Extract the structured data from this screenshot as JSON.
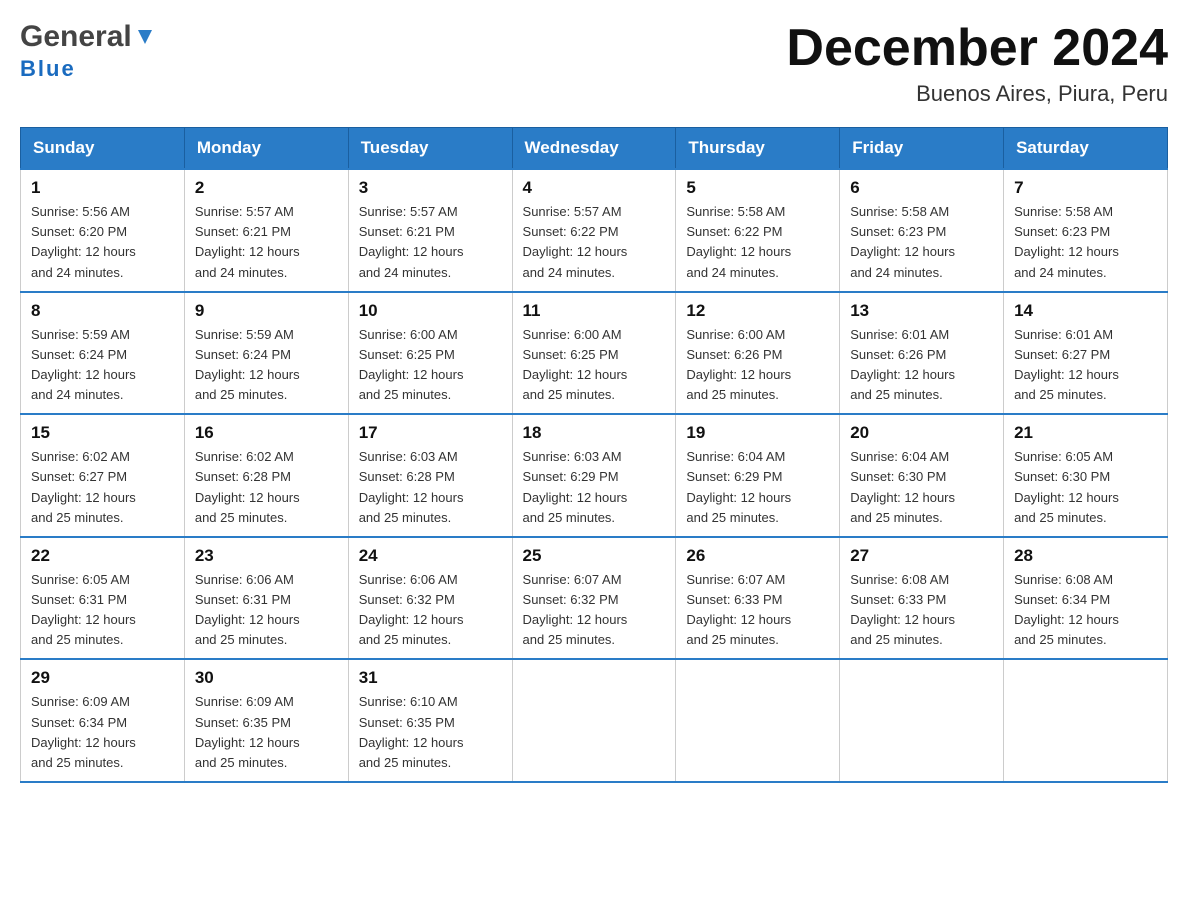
{
  "header": {
    "logo_general": "General",
    "logo_blue": "Blue",
    "title": "December 2024",
    "subtitle": "Buenos Aires, Piura, Peru"
  },
  "days_of_week": [
    "Sunday",
    "Monday",
    "Tuesday",
    "Wednesday",
    "Thursday",
    "Friday",
    "Saturday"
  ],
  "weeks": [
    [
      {
        "day": "1",
        "sunrise": "5:56 AM",
        "sunset": "6:20 PM",
        "daylight": "12 hours and 24 minutes."
      },
      {
        "day": "2",
        "sunrise": "5:57 AM",
        "sunset": "6:21 PM",
        "daylight": "12 hours and 24 minutes."
      },
      {
        "day": "3",
        "sunrise": "5:57 AM",
        "sunset": "6:21 PM",
        "daylight": "12 hours and 24 minutes."
      },
      {
        "day": "4",
        "sunrise": "5:57 AM",
        "sunset": "6:22 PM",
        "daylight": "12 hours and 24 minutes."
      },
      {
        "day": "5",
        "sunrise": "5:58 AM",
        "sunset": "6:22 PM",
        "daylight": "12 hours and 24 minutes."
      },
      {
        "day": "6",
        "sunrise": "5:58 AM",
        "sunset": "6:23 PM",
        "daylight": "12 hours and 24 minutes."
      },
      {
        "day": "7",
        "sunrise": "5:58 AM",
        "sunset": "6:23 PM",
        "daylight": "12 hours and 24 minutes."
      }
    ],
    [
      {
        "day": "8",
        "sunrise": "5:59 AM",
        "sunset": "6:24 PM",
        "daylight": "12 hours and 24 minutes."
      },
      {
        "day": "9",
        "sunrise": "5:59 AM",
        "sunset": "6:24 PM",
        "daylight": "12 hours and 25 minutes."
      },
      {
        "day": "10",
        "sunrise": "6:00 AM",
        "sunset": "6:25 PM",
        "daylight": "12 hours and 25 minutes."
      },
      {
        "day": "11",
        "sunrise": "6:00 AM",
        "sunset": "6:25 PM",
        "daylight": "12 hours and 25 minutes."
      },
      {
        "day": "12",
        "sunrise": "6:00 AM",
        "sunset": "6:26 PM",
        "daylight": "12 hours and 25 minutes."
      },
      {
        "day": "13",
        "sunrise": "6:01 AM",
        "sunset": "6:26 PM",
        "daylight": "12 hours and 25 minutes."
      },
      {
        "day": "14",
        "sunrise": "6:01 AM",
        "sunset": "6:27 PM",
        "daylight": "12 hours and 25 minutes."
      }
    ],
    [
      {
        "day": "15",
        "sunrise": "6:02 AM",
        "sunset": "6:27 PM",
        "daylight": "12 hours and 25 minutes."
      },
      {
        "day": "16",
        "sunrise": "6:02 AM",
        "sunset": "6:28 PM",
        "daylight": "12 hours and 25 minutes."
      },
      {
        "day": "17",
        "sunrise": "6:03 AM",
        "sunset": "6:28 PM",
        "daylight": "12 hours and 25 minutes."
      },
      {
        "day": "18",
        "sunrise": "6:03 AM",
        "sunset": "6:29 PM",
        "daylight": "12 hours and 25 minutes."
      },
      {
        "day": "19",
        "sunrise": "6:04 AM",
        "sunset": "6:29 PM",
        "daylight": "12 hours and 25 minutes."
      },
      {
        "day": "20",
        "sunrise": "6:04 AM",
        "sunset": "6:30 PM",
        "daylight": "12 hours and 25 minutes."
      },
      {
        "day": "21",
        "sunrise": "6:05 AM",
        "sunset": "6:30 PM",
        "daylight": "12 hours and 25 minutes."
      }
    ],
    [
      {
        "day": "22",
        "sunrise": "6:05 AM",
        "sunset": "6:31 PM",
        "daylight": "12 hours and 25 minutes."
      },
      {
        "day": "23",
        "sunrise": "6:06 AM",
        "sunset": "6:31 PM",
        "daylight": "12 hours and 25 minutes."
      },
      {
        "day": "24",
        "sunrise": "6:06 AM",
        "sunset": "6:32 PM",
        "daylight": "12 hours and 25 minutes."
      },
      {
        "day": "25",
        "sunrise": "6:07 AM",
        "sunset": "6:32 PM",
        "daylight": "12 hours and 25 minutes."
      },
      {
        "day": "26",
        "sunrise": "6:07 AM",
        "sunset": "6:33 PM",
        "daylight": "12 hours and 25 minutes."
      },
      {
        "day": "27",
        "sunrise": "6:08 AM",
        "sunset": "6:33 PM",
        "daylight": "12 hours and 25 minutes."
      },
      {
        "day": "28",
        "sunrise": "6:08 AM",
        "sunset": "6:34 PM",
        "daylight": "12 hours and 25 minutes."
      }
    ],
    [
      {
        "day": "29",
        "sunrise": "6:09 AM",
        "sunset": "6:34 PM",
        "daylight": "12 hours and 25 minutes."
      },
      {
        "day": "30",
        "sunrise": "6:09 AM",
        "sunset": "6:35 PM",
        "daylight": "12 hours and 25 minutes."
      },
      {
        "day": "31",
        "sunrise": "6:10 AM",
        "sunset": "6:35 PM",
        "daylight": "12 hours and 25 minutes."
      },
      null,
      null,
      null,
      null
    ]
  ],
  "labels": {
    "sunrise": "Sunrise:",
    "sunset": "Sunset:",
    "daylight": "Daylight:"
  }
}
